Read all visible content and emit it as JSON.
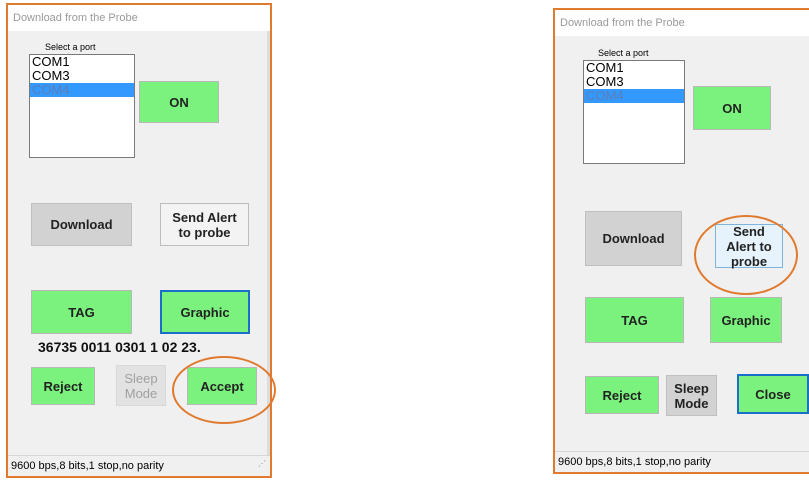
{
  "left_window": {
    "title": "Download from the  Probe",
    "port_label": "Select a port",
    "ports": [
      "COM1",
      "COM3",
      "COM4"
    ],
    "selected_port": "COM4",
    "on_label": "ON",
    "download_label": "Download",
    "send_alert_label": "Send Alert to probe",
    "tag_label": "TAG",
    "graphic_label": "Graphic",
    "code_text": "36735 0011 0301 1 02 23.",
    "reject_label": "Reject",
    "sleep_label": "Sleep Mode",
    "accept_label": "Accept",
    "status": "9600 bps,8 bits,1 stop,no parity"
  },
  "right_window": {
    "title": "Download from the  Probe",
    "port_label": "Select a port",
    "ports": [
      "COM1",
      "COM3",
      "COM4"
    ],
    "selected_port": "COM4",
    "on_label": "ON",
    "download_label": "Download",
    "send_alert_label": "Send Alert to probe",
    "tag_label": "TAG",
    "graphic_label": "Graphic",
    "reject_label": "Reject",
    "sleep_label": "Sleep Mode",
    "close_label": "Close",
    "status": "9600 bps,8 bits,1 stop,no parity"
  },
  "colors": {
    "highlight_ring": "#e07a2e",
    "green_button": "#7cf27e",
    "selection": "#3399ff",
    "focus_border": "#1c6fc9"
  }
}
